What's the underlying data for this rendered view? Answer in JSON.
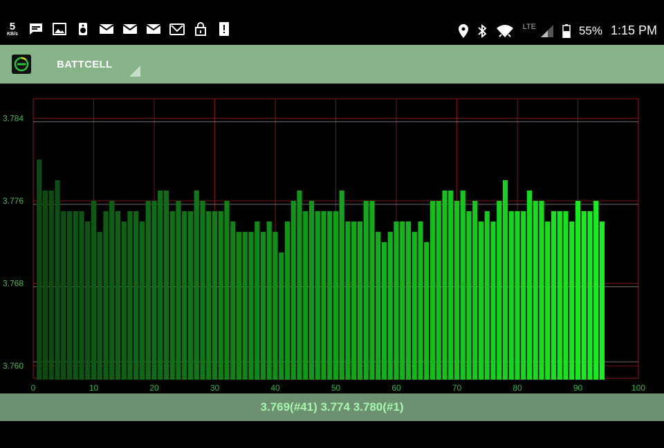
{
  "status_bar": {
    "net_speed": "5",
    "net_unit": "KB/s",
    "notification_icons": [
      "chat-icon",
      "image-icon",
      "speaker-icon",
      "mail-icon",
      "mail-icon",
      "mail-icon",
      "mail-open-icon",
      "lock-icon",
      "alert-icon"
    ],
    "network_type": "LTE",
    "battery_percent": "55%",
    "time": "1:15 PM"
  },
  "toolbar": {
    "app_title": "BATTCELL",
    "logo_icon": "app-logo-icon",
    "dropdown_icon": "dropdown-triangle-icon"
  },
  "colors": {
    "grid_red": "#7a1414",
    "bar_dark": "#0b4a12",
    "bar_light": "#17f01f",
    "toolbar_bg": "#86b388",
    "footer_bg": "#6d9170"
  },
  "chart_data": {
    "type": "bar",
    "x": [
      1,
      2,
      3,
      4,
      5,
      6,
      7,
      8,
      9,
      10,
      11,
      12,
      13,
      14,
      15,
      16,
      17,
      18,
      19,
      20,
      21,
      22,
      23,
      24,
      25,
      26,
      27,
      28,
      29,
      30,
      31,
      32,
      33,
      34,
      35,
      36,
      37,
      38,
      39,
      40,
      41,
      42,
      43,
      44,
      45,
      46,
      47,
      48,
      49,
      50,
      51,
      52,
      53,
      54,
      55,
      56,
      57,
      58,
      59,
      60,
      61,
      62,
      63,
      64,
      65,
      66,
      67,
      68,
      69,
      70,
      71,
      72,
      73,
      74,
      75,
      76,
      77,
      78,
      79,
      80,
      81,
      82,
      83,
      84,
      85,
      86,
      87,
      88,
      89,
      90,
      91,
      92,
      93,
      94,
      95
    ],
    "values": [
      3.78,
      3.777,
      3.777,
      3.778,
      3.775,
      3.775,
      3.775,
      3.775,
      3.774,
      3.776,
      3.773,
      3.775,
      3.776,
      3.775,
      3.774,
      3.775,
      3.775,
      3.774,
      3.776,
      3.776,
      3.777,
      3.777,
      3.775,
      3.776,
      3.775,
      3.775,
      3.777,
      3.776,
      3.775,
      3.775,
      3.775,
      3.776,
      3.774,
      3.773,
      3.773,
      3.773,
      3.774,
      3.773,
      3.774,
      3.773,
      3.771,
      3.774,
      3.776,
      3.777,
      3.775,
      3.776,
      3.775,
      3.775,
      3.775,
      3.775,
      3.777,
      3.774,
      3.774,
      3.774,
      3.776,
      3.776,
      3.773,
      3.772,
      3.773,
      3.774,
      3.774,
      3.774,
      3.773,
      3.774,
      3.772,
      3.776,
      3.776,
      3.777,
      3.777,
      3.776,
      3.777,
      3.775,
      3.776,
      3.774,
      3.775,
      3.774,
      3.776,
      3.778,
      3.775,
      3.775,
      3.775,
      3.777,
      3.776,
      3.776,
      3.774,
      3.775,
      3.775,
      3.775,
      3.774,
      3.776,
      3.775,
      3.775,
      3.776,
      3.774
    ],
    "xlim": [
      0,
      100
    ],
    "ylim": [
      3.7588,
      3.7859
    ],
    "x_ticks": [
      0,
      10,
      20,
      30,
      40,
      50,
      60,
      70,
      80,
      90,
      100
    ],
    "y_ticks": [
      3.76,
      3.768,
      3.776,
      3.784
    ],
    "y_tick_labels": [
      "3.760",
      "3.768",
      "3.776",
      "3.784"
    ],
    "grid": true
  },
  "footer": {
    "summary": "3.769(#41) 3.774 3.780(#1)"
  }
}
